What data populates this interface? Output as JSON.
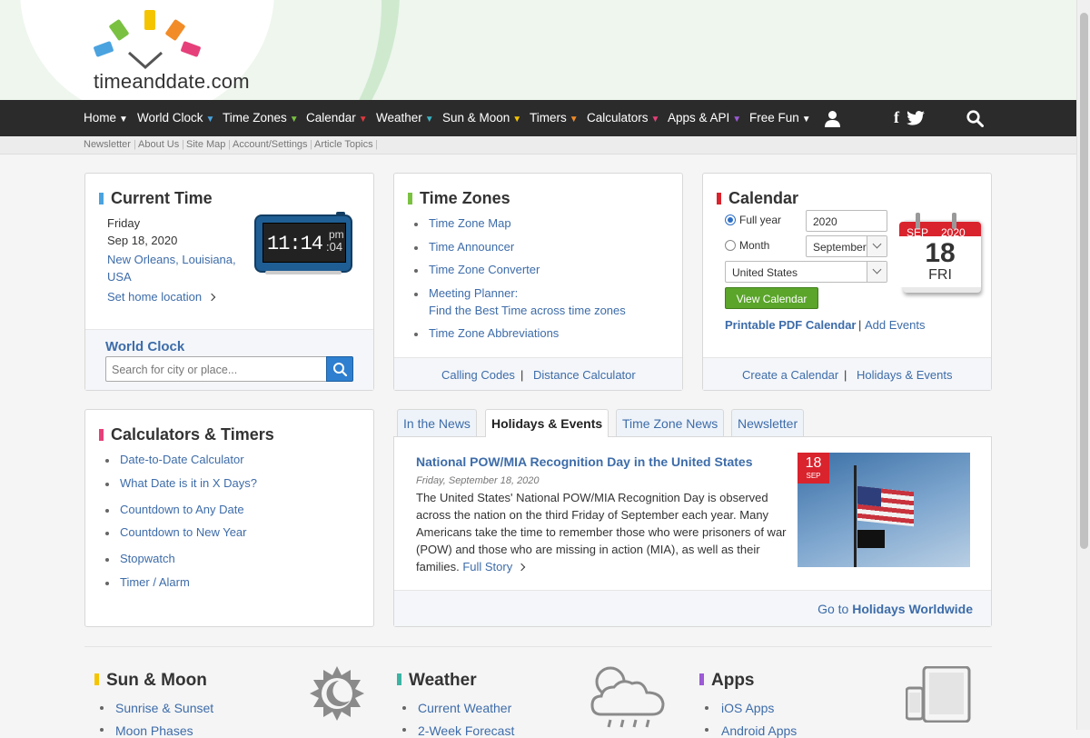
{
  "logo": {
    "text": "timeanddate.com"
  },
  "nav": {
    "items": [
      {
        "label": "Home",
        "tri": "▼",
        "color": "#ffffff"
      },
      {
        "label": "World Clock",
        "tri": "▼",
        "color": "#4aa3df"
      },
      {
        "label": "Time Zones",
        "tri": "▼",
        "color": "#7ac142"
      },
      {
        "label": "Calendar",
        "tri": "▼",
        "color": "#e0393e"
      },
      {
        "label": "Weather",
        "tri": "▼",
        "color": "#3cb4c4"
      },
      {
        "label": "Sun & Moon",
        "tri": "▼",
        "color": "#f5c400"
      },
      {
        "label": "Timers",
        "tri": "▼",
        "color": "#f28c28"
      },
      {
        "label": "Calculators",
        "tri": "▼",
        "color": "#e6407a"
      },
      {
        "label": "Apps & API",
        "tri": "▼",
        "color": "#9c5ad6"
      },
      {
        "label": "Free Fun",
        "tri": "▼",
        "color": "#ffffff"
      }
    ],
    "facebook_glyph": "f"
  },
  "subnav": [
    "Newsletter",
    "About Us",
    "Site Map",
    "Account/Settings",
    "Article Topics"
  ],
  "current_time": {
    "title": "Current Time",
    "day": "Friday",
    "date": "Sep 18, 2020",
    "location": "New Orleans, Louisiana, USA",
    "set_home": "Set home location",
    "clock_time": "11:14",
    "clock_ampm": "pm",
    "clock_seconds": ":04",
    "world_clock_label": "World Clock",
    "search_placeholder": "Search for city or place..."
  },
  "time_zones": {
    "title": "Time Zones",
    "links": [
      "Time Zone Map",
      "Time Announcer",
      "Time Zone Converter",
      "Meeting Planner:",
      "Time Zone Abbreviations"
    ],
    "meeting_sub": "Find the Best Time across time zones",
    "footer_links": [
      "Calling Codes",
      "Distance Calculator"
    ],
    "footer_sep": "|"
  },
  "calendar": {
    "title": "Calendar",
    "full_year_label": "Full year",
    "year_value": "2020",
    "month_label": "Month",
    "month_value": "September",
    "country_value": "United States",
    "view_button": "View Calendar",
    "printable": "Printable PDF Calendar",
    "sep": "|",
    "add_events": "Add Events",
    "icon_month": "SEP",
    "icon_year": "2020",
    "icon_day": "18",
    "icon_weekday": "FRI",
    "footer_links": [
      "Create a Calendar",
      "Holidays & Events"
    ]
  },
  "calculators": {
    "title": "Calculators & Timers",
    "links": [
      "Date-to-Date Calculator",
      "What Date is it in X Days?",
      "Countdown to Any Date",
      "Countdown to New Year",
      "Stopwatch",
      "Timer / Alarm"
    ]
  },
  "news": {
    "tabs": [
      "In the News",
      "Holidays & Events",
      "Time Zone News",
      "Newsletter"
    ],
    "active_tab": 1,
    "headline": "National POW/MIA Recognition Day in the United States",
    "date": "Friday, September 18, 2020",
    "body": "The United States' National POW/MIA Recognition Day is observed across the nation on the third Friday of September each year. Many Americans take the time to remember those who were prisoners of war (POW) and those who are missing in action (MIA), as well as their families.",
    "full_story": "Full Story",
    "badge_day": "18",
    "badge_month": "SEP",
    "footer_prefix": "Go to",
    "footer_link": "Holidays Worldwide"
  },
  "bottom": {
    "sun_moon": {
      "title": "Sun & Moon",
      "links": [
        "Sunrise & Sunset",
        "Moon Phases"
      ]
    },
    "weather": {
      "title": "Weather",
      "links": [
        "Current Weather",
        "2-Week Forecast"
      ]
    },
    "apps": {
      "title": "Apps",
      "links": [
        "iOS Apps",
        "Android Apps"
      ]
    }
  },
  "colors": {
    "world_clock": "#4aa3df",
    "time_zones": "#7ac142",
    "calendar": "#d9232d",
    "calculators": "#e6407a",
    "sun_moon": "#f5c400",
    "weather": "#3cb4a4",
    "apps": "#9c5ad6",
    "link": "#3d6ca9",
    "button_green": "#5aa52a",
    "nav_bg": "#2b2b2b"
  }
}
